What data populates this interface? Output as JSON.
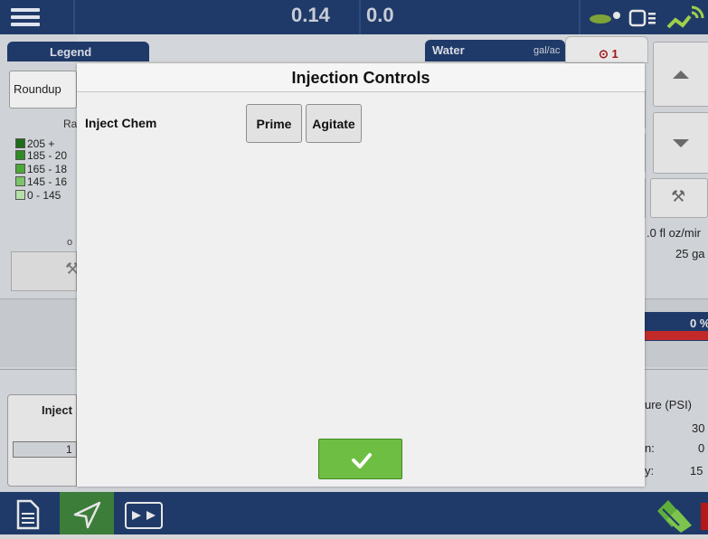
{
  "topbar": {
    "value_1": "0.14",
    "value_2": "0.0"
  },
  "legend": {
    "title": "Legend",
    "product": "Roundup",
    "rate_header": "Ra",
    "items": [
      {
        "label": "205 +",
        "color": "#1f6b1a"
      },
      {
        "label": "185 - 20",
        "color": "#2f8a26"
      },
      {
        "label": "165 - 18",
        "color": "#4da83a"
      },
      {
        "label": "145 - 16",
        "color": "#7cc46a"
      },
      {
        "label": "0 - 145",
        "color": "#b7e0a8"
      }
    ],
    "dot": "o"
  },
  "water": {
    "title": "Water",
    "unit": "gal/ac"
  },
  "alarm": {
    "label": "⊙ 1"
  },
  "right_panel": {
    "rate": ".0 fl oz/mir",
    "volume": "25 ga",
    "progress_pct": "0 %",
    "pressure_label": "ure (PSI)",
    "rows": [
      {
        "label": "",
        "value": "30"
      },
      {
        "label": "n:",
        "value": "0"
      },
      {
        "label": "y:",
        "value": "15"
      }
    ]
  },
  "inject_panel": {
    "label": "Inject",
    "value": "1"
  },
  "dialog": {
    "title": "Injection Controls",
    "row_label": "Inject Chem",
    "prime_label": "Prime",
    "agitate_label": "Agitate",
    "ok_icon": "checkmark-icon"
  },
  "bottombar": {
    "icons": [
      "document-icon",
      "navigate-arrow-icon",
      "split-screen-icon",
      "logo-icon"
    ]
  },
  "colors": {
    "navy": "#1f3a68",
    "green_active": "#3c7d3a",
    "ok_green": "#6fbe44",
    "alarm_red": "#a01515"
  }
}
